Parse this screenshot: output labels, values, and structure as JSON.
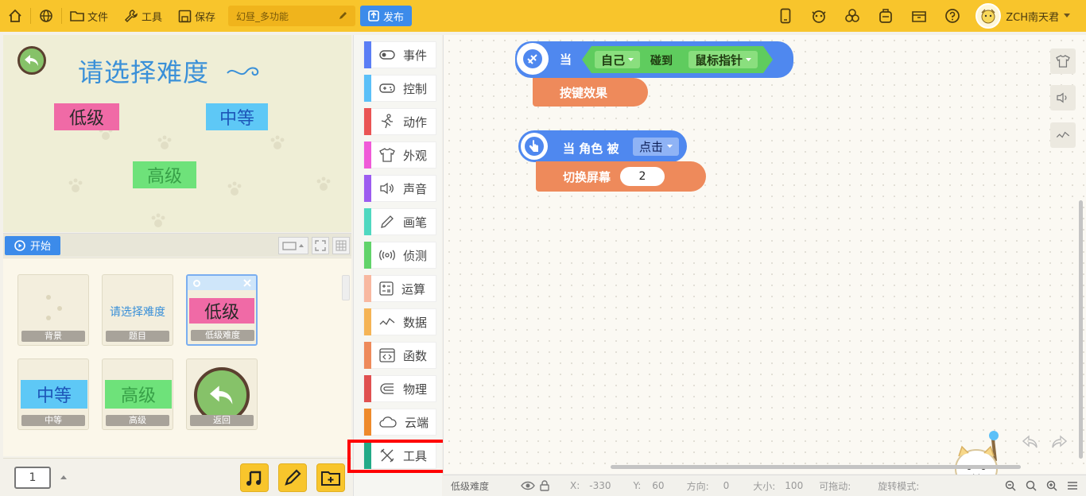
{
  "topbar": {
    "menu_file": "文件",
    "menu_tools": "工具",
    "menu_save": "保存",
    "project_title": "幻昼_多功能",
    "publish": "发布",
    "username": "ZCH南天君"
  },
  "stage": {
    "title": "请选择难度",
    "level_low": "低级",
    "level_mid": "中等",
    "level_high": "高级",
    "start": "开始"
  },
  "sprites": [
    {
      "label": "背景"
    },
    {
      "label": "题目",
      "preview": "请选择难度"
    },
    {
      "label": "低级难度",
      "preview": "低级"
    },
    {
      "label": "中等",
      "preview": "中等"
    },
    {
      "label": "高级",
      "preview": "高级"
    },
    {
      "label": "返回"
    }
  ],
  "page_number": "1",
  "categories": [
    {
      "label": "事件",
      "color": "#5b7ef5"
    },
    {
      "label": "控制",
      "color": "#5bc0f8"
    },
    {
      "label": "动作",
      "color": "#ea5454"
    },
    {
      "label": "外观",
      "color": "#f05ad8"
    },
    {
      "label": "声音",
      "color": "#9d5cf0"
    },
    {
      "label": "画笔",
      "color": "#4fd8c0"
    },
    {
      "label": "侦测",
      "color": "#61d36a"
    },
    {
      "label": "运算",
      "color": "#f8b8a0"
    },
    {
      "label": "数据",
      "color": "#f5b455"
    },
    {
      "label": "函数",
      "color": "#ee8a5b"
    },
    {
      "label": "物理",
      "color": "#e05050"
    },
    {
      "label": "云端",
      "color": "#ee8a2b"
    },
    {
      "label": "工具",
      "color": "#22aa88"
    }
  ],
  "blocks": {
    "when": "当",
    "self": "自己",
    "touch": "碰到",
    "mouse": "鼠标指针",
    "key_effect": "按键效果",
    "when_sprite": "当 角色 被",
    "click": "点击",
    "switch_screen": "切换屏幕",
    "screen_num": "2"
  },
  "status": {
    "sprite_name": "低级难度",
    "x_label": "X:",
    "x_val": "-330",
    "y_label": "Y:",
    "y_val": "60",
    "dir_label": "方向:",
    "dir_val": "0",
    "size_label": "大小:",
    "size_val": "100",
    "drag_label": "可拖动:",
    "rot_label": "旋转模式:"
  }
}
